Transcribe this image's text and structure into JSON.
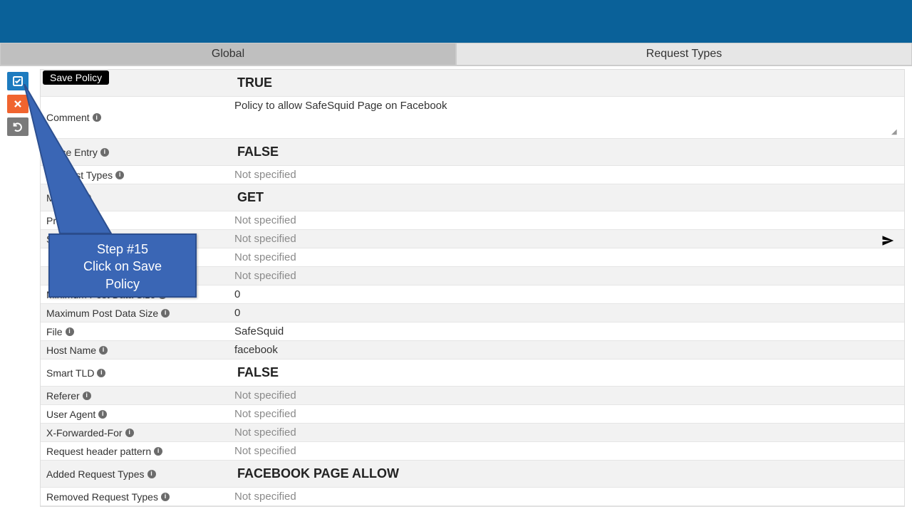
{
  "tabs": {
    "global": "Global",
    "request_types": "Request Types"
  },
  "tooltip": {
    "save": "Save Policy"
  },
  "callout": {
    "line1": "Step #15",
    "line2": "Click on Save",
    "line3": "Policy"
  },
  "rows": [
    {
      "label": "",
      "value": "TRUE",
      "style": "bold",
      "alt": true
    },
    {
      "label": "Comment",
      "value": "Policy to allow SafeSquid Page on Facebook",
      "style": "textarea",
      "alt": false
    },
    {
      "label": "Trace Entry",
      "value": "FALSE",
      "style": "bold",
      "alt": true
    },
    {
      "label": "Request Types",
      "value": "Not specified",
      "style": "muted",
      "alt": false
    },
    {
      "label": "Method",
      "value": "GET",
      "style": "bold",
      "alt": true
    },
    {
      "label": "Protocol",
      "value": "Not specified",
      "style": "muted",
      "alt": false
    },
    {
      "label": "Source Port",
      "value": "Not specified",
      "style": "muted-send",
      "alt": true
    },
    {
      "label": "",
      "value": "Not specified",
      "style": "muted",
      "alt": false
    },
    {
      "label": "",
      "value": "Not specified",
      "style": "muted",
      "alt": true
    },
    {
      "label": "Minimum Post Data Size",
      "value": "0",
      "style": "plain",
      "alt": false
    },
    {
      "label": "Maximum Post Data Size",
      "value": "0",
      "style": "plain",
      "alt": true
    },
    {
      "label": "File",
      "value": "SafeSquid",
      "style": "plain",
      "alt": false
    },
    {
      "label": "Host Name",
      "value": "facebook",
      "style": "plain",
      "alt": true
    },
    {
      "label": "Smart TLD",
      "value": "FALSE",
      "style": "bold",
      "alt": false
    },
    {
      "label": "Referer",
      "value": "Not specified",
      "style": "muted",
      "alt": true
    },
    {
      "label": "User Agent",
      "value": "Not specified",
      "style": "muted",
      "alt": false
    },
    {
      "label": "X-Forwarded-For",
      "value": "Not specified",
      "style": "muted",
      "alt": true
    },
    {
      "label": "Request header pattern",
      "value": "Not specified",
      "style": "muted",
      "alt": false
    },
    {
      "label": "Added Request Types",
      "value": "FACEBOOK PAGE ALLOW",
      "style": "bold",
      "alt": true
    },
    {
      "label": "Removed Request Types",
      "value": "Not specified",
      "style": "muted",
      "alt": false
    }
  ]
}
